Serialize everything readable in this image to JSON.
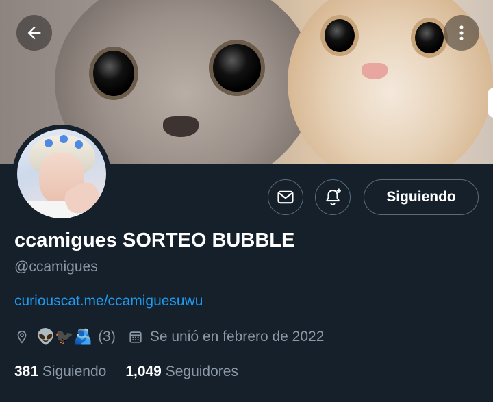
{
  "profile": {
    "display_name": "ccamigues SORTEO BUBBLE",
    "handle": "@ccamigues",
    "link": "curiouscat.me/ccamiguesuwu",
    "location_emoji": "👽🐦‍⬛🫂",
    "location_extra": "(3)",
    "joined": "Se unió en febrero de 2022"
  },
  "actions": {
    "follow_label": "Siguiendo"
  },
  "stats": {
    "following_count": "381",
    "following_label": "Siguiendo",
    "followers_count": "1,049",
    "followers_label": "Seguidores"
  },
  "icons": {
    "back": "arrow-left-icon",
    "more": "more-vertical-icon",
    "message": "mail-icon",
    "notifications": "bell-plus-icon",
    "location": "location-pin-icon",
    "calendar": "calendar-icon"
  },
  "colors": {
    "background": "#15202b",
    "accent": "#1d9bf0",
    "secondary_text": "#8b98a5",
    "border": "#5b6b78"
  }
}
